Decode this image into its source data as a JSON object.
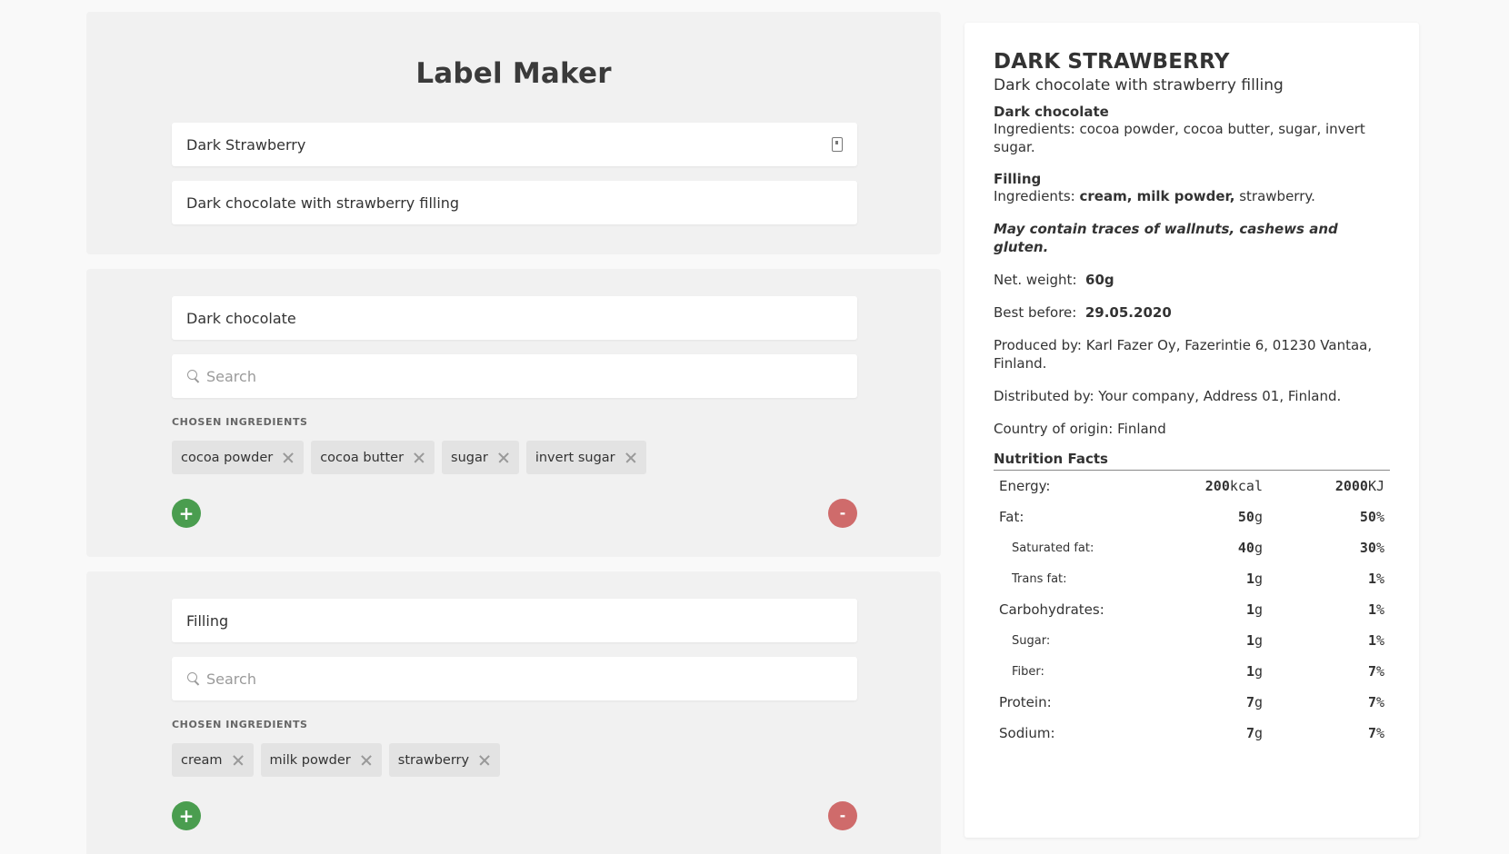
{
  "app": {
    "title": "Label Maker"
  },
  "header": {
    "product_name": "Dark Strawberry",
    "product_description": "Dark chocolate with strawberry filling"
  },
  "sections": [
    {
      "name": "Dark chocolate",
      "search_placeholder": "Search",
      "chosen_label": "CHOSEN INGREDIENTS",
      "chips": [
        "cocoa powder",
        "cocoa butter",
        "sugar",
        "invert sugar"
      ]
    },
    {
      "name": "Filling",
      "search_placeholder": "Search",
      "chosen_label": "CHOSEN INGREDIENTS",
      "chips": [
        "cream",
        "milk powder",
        "strawberry"
      ]
    }
  ],
  "buttons": {
    "add": "+",
    "remove": "-"
  },
  "label": {
    "title": "DARK STRAWBERRY",
    "subtitle": "Dark chocolate with strawberry filling",
    "sec1_name": "Dark chocolate",
    "sec1_prefix": "Ingredients:",
    "sec1_list": "cocoa powder, cocoa butter, sugar, invert sugar.",
    "sec2_name": "Filling",
    "sec2_prefix": "Ingredients:",
    "sec2_bold": "cream, milk powder,",
    "sec2_rest": "strawberry.",
    "allergens": "May contain traces of wallnuts, cashews and gluten.",
    "weight_label": "Net. weight:",
    "weight_value": "60g",
    "best_label": "Best before:",
    "best_value": "29.05.2020",
    "produced": "Produced by: Karl Fazer Oy, Fazerintie 6, 01230 Vantaa, Finland.",
    "distributed": "Distributed by: Your company, Address 01, Finland.",
    "origin": "Country of origin: Finland",
    "nutrition_title": "Nutrition Facts",
    "nutrition": [
      {
        "name": "Energy:",
        "val": "200",
        "unit": "kcal",
        "pct": "2000",
        "pct_unit": "KJ"
      },
      {
        "name": "Fat:",
        "val": "50",
        "unit": "g",
        "pct": "50",
        "pct_unit": "%"
      },
      {
        "name": "Saturated fat:",
        "val": "40",
        "unit": "g",
        "pct": "30",
        "pct_unit": "%"
      },
      {
        "name": "Trans fat:",
        "val": "1",
        "unit": "g",
        "pct": "1",
        "pct_unit": "%"
      },
      {
        "name": "Carbohydrates:",
        "val": "1",
        "unit": "g",
        "pct": "1",
        "pct_unit": "%"
      },
      {
        "name": "Sugar:",
        "val": "1",
        "unit": "g",
        "pct": "1",
        "pct_unit": "%"
      },
      {
        "name": "Fiber:",
        "val": "1",
        "unit": "g",
        "pct": "7",
        "pct_unit": "%"
      },
      {
        "name": "Protein:",
        "val": "7",
        "unit": "g",
        "pct": "7",
        "pct_unit": "%"
      },
      {
        "name": "Sodium:",
        "val": "7",
        "unit": "g",
        "pct": "7",
        "pct_unit": "%"
      }
    ]
  }
}
